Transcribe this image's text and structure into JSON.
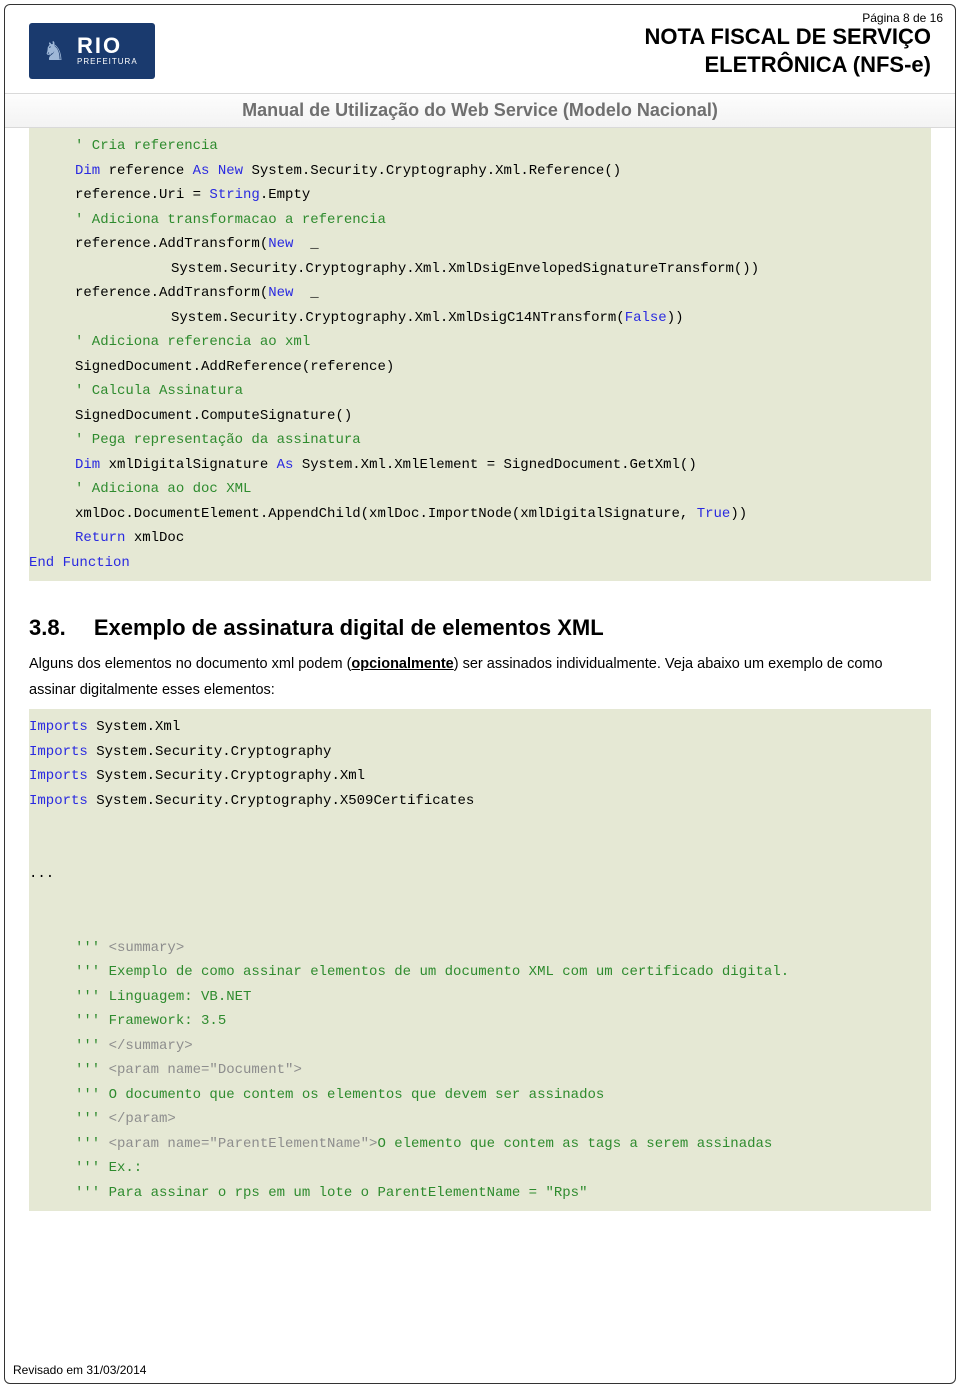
{
  "page_label": "Página 8 de 16",
  "logo": {
    "rio": "RIO",
    "sub": "PREFEITURA"
  },
  "maintitle_l1": "NOTA FISCAL DE SERVIÇO",
  "maintitle_l2": "ELETRÔNICA (NFS-e)",
  "subtitle": "Manual de Utilização do Web Service (Modelo Nacional)",
  "code1": {
    "l1_c": "' Cria referencia",
    "l2_a": "Dim",
    "l2_b": " reference ",
    "l2_c": "As",
    "l2_d": " ",
    "l2_e": "New",
    "l2_f": " System.Security.Cryptography.Xml.Reference()",
    "l3": "reference.Uri = ",
    "l3_k": "String",
    "l3_b": ".Empty",
    "l4_c": "' Adiciona transformacao a referencia",
    "l5_a": "reference.AddTransform(",
    "l5_k": "New",
    "l5_b": "  _",
    "l6": "System.Security.Cryptography.Xml.XmlDsigEnvelopedSignatureTransform())",
    "l7_a": "reference.AddTransform(",
    "l7_k": "New",
    "l7_b": "  _",
    "l8_a": "System.Security.Cryptography.Xml.XmlDsigC14NTransform(",
    "l8_k": "False",
    "l8_b": "))",
    "l9_c": "' Adiciona referencia ao xml",
    "l10": "SignedDocument.AddReference(reference)",
    "l11_c": "' Calcula Assinatura",
    "l12": "SignedDocument.ComputeSignature()",
    "l13_c": "' Pega representação da assinatura",
    "l14_a": "Dim",
    "l14_b": " xmlDigitalSignature ",
    "l14_c": "As",
    "l14_d": " System.Xml.XmlElement = SignedDocument.GetXml()",
    "l15_c": "' Adiciona ao doc XML",
    "l16_a": "xmlDoc.DocumentElement.AppendChild(xmlDoc.ImportNode(xmlDigitalSignature, ",
    "l16_k": "True",
    "l16_b": "))",
    "l17_k": "Return",
    "l17_b": " xmlDoc",
    "l18_a": "End",
    "l18_b": " ",
    "l18_c": "Function"
  },
  "section": {
    "num": "3.8.",
    "title": "Exemplo de assinatura digital de elementos XML"
  },
  "para1_a": "Alguns dos elementos no documento  xml podem (",
  "para1_b": "opcionalmente",
  "para1_c": ") ser assinados individualmente. Veja abaixo um exemplo de como assinar digitalmente esses elementos:",
  "code2": {
    "l1_k": "Imports",
    "l1_b": " System.Xml",
    "l2_k": "Imports",
    "l2_b": " System.Security.Cryptography",
    "l3_k": "Imports",
    "l3_b": " System.Security.Cryptography.Xml",
    "l4_k": "Imports",
    "l4_b": " System.Security.Cryptography.X509Certificates",
    "dots": "...",
    "s1_a": "''' ",
    "s1_b": "<summary>",
    "s2": "''' Exemplo de como assinar elementos de um documento XML com um certificado digital.",
    "s3": "''' Linguagem: VB.NET",
    "s4": "''' Framework: 3.5",
    "s5_a": "''' ",
    "s5_b": "</summary>",
    "s6_a": "''' ",
    "s6_b": "<param name=\"Document\">",
    "s7": "''' O documento que contem os elementos que devem ser assinados",
    "s8_a": "''' ",
    "s8_b": "</param>",
    "s9_a": "''' ",
    "s9_b": "<param name=\"ParentElementName\">",
    "s9_c": "O elemento que contem as tags a serem assinadas",
    "s10": "''' Ex.:",
    "s11": "''' Para assinar o rps em um lote o ParentElementName = \"Rps\""
  },
  "footer": "Revisado em 31/03/2014"
}
